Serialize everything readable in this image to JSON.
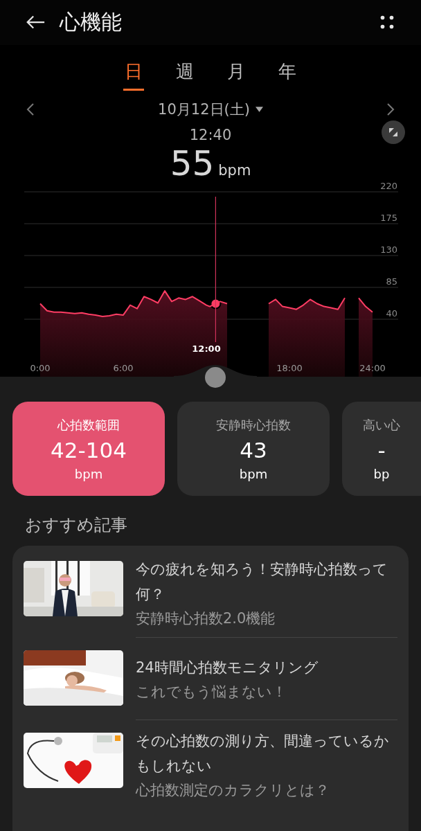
{
  "header": {
    "title": "心機能"
  },
  "tabs": [
    {
      "label": "日",
      "selected": true
    },
    {
      "label": "週",
      "selected": false
    },
    {
      "label": "月",
      "selected": false
    },
    {
      "label": "年",
      "selected": false
    }
  ],
  "date": {
    "label": "10月12日(土)"
  },
  "reading": {
    "time": "12:40",
    "value": "55",
    "unit": "bpm"
  },
  "chart_data": {
    "type": "area",
    "grid": true,
    "x": [
      0,
      0.5,
      1,
      1.5,
      2,
      2.5,
      3,
      3.5,
      4,
      4.5,
      5,
      5.5,
      6,
      6.5,
      7,
      7.5,
      8,
      8.5,
      9,
      9.5,
      10,
      10.5,
      11,
      11.5,
      12,
      12.25,
      13,
      13.5,
      14,
      14.5,
      15,
      15.5,
      16,
      16.5,
      17,
      17.5,
      18,
      18.5,
      19,
      19.5,
      20,
      20.5,
      21,
      21.5,
      22,
      22.5,
      23,
      23.5,
      24
    ],
    "series": [
      {
        "color": "#ff3d64",
        "values": [
          62,
          52,
          50,
          50,
          49,
          48,
          49,
          47,
          46,
          44,
          45,
          47,
          46,
          60,
          55,
          72,
          68,
          63,
          80,
          65,
          70,
          68,
          72,
          66,
          60,
          58,
          65,
          62,
          null,
          null,
          null,
          null,
          null,
          62,
          68,
          58,
          56,
          54,
          60,
          68,
          62,
          58,
          56,
          54,
          70,
          null,
          70,
          58,
          50
        ]
      }
    ],
    "xlim": [
      0,
      24
    ],
    "ylim": [
      40,
      220
    ],
    "xticks": [
      {
        "value": 0,
        "label": "0:00"
      },
      {
        "value": 6,
        "label": "6:00"
      },
      {
        "value": 18,
        "label": "18:00"
      },
      {
        "value": 24,
        "label": "24:00"
      }
    ],
    "yticks": [
      40,
      85,
      130,
      175,
      220
    ],
    "ref_lines": [
      {
        "axis": "x",
        "value": 12.67
      }
    ]
  },
  "cursor_label": "12:00",
  "cards": [
    {
      "label": "心拍数範囲",
      "value": "42-104",
      "unit": "bpm",
      "selected": true
    },
    {
      "label": "安静時心拍数",
      "value": "43",
      "unit": "bpm",
      "selected": false
    },
    {
      "label": "高い心",
      "value": "-",
      "unit": "bp",
      "selected": false
    }
  ],
  "articles_heading": "おすすめ記事",
  "articles": [
    {
      "title": "今の疲れを知ろう！安静時心拍数って何？",
      "subtitle": "安静時心拍数2.0機能"
    },
    {
      "title": "24時間心拍数モニタリング",
      "subtitle": "これでもう悩まない！"
    },
    {
      "title": "その心拍数の測り方、間違っているかもしれない",
      "subtitle": "心拍数測定のカラクリとは？"
    }
  ]
}
